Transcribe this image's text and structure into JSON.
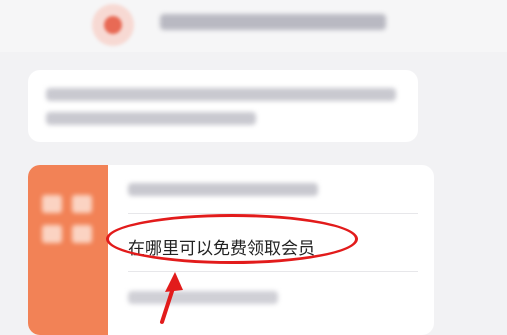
{
  "chat": {
    "faq_card": {
      "highlighted_question": "在哪里可以免费领取会员"
    }
  },
  "annotation": {
    "color": "#e21b1b"
  }
}
